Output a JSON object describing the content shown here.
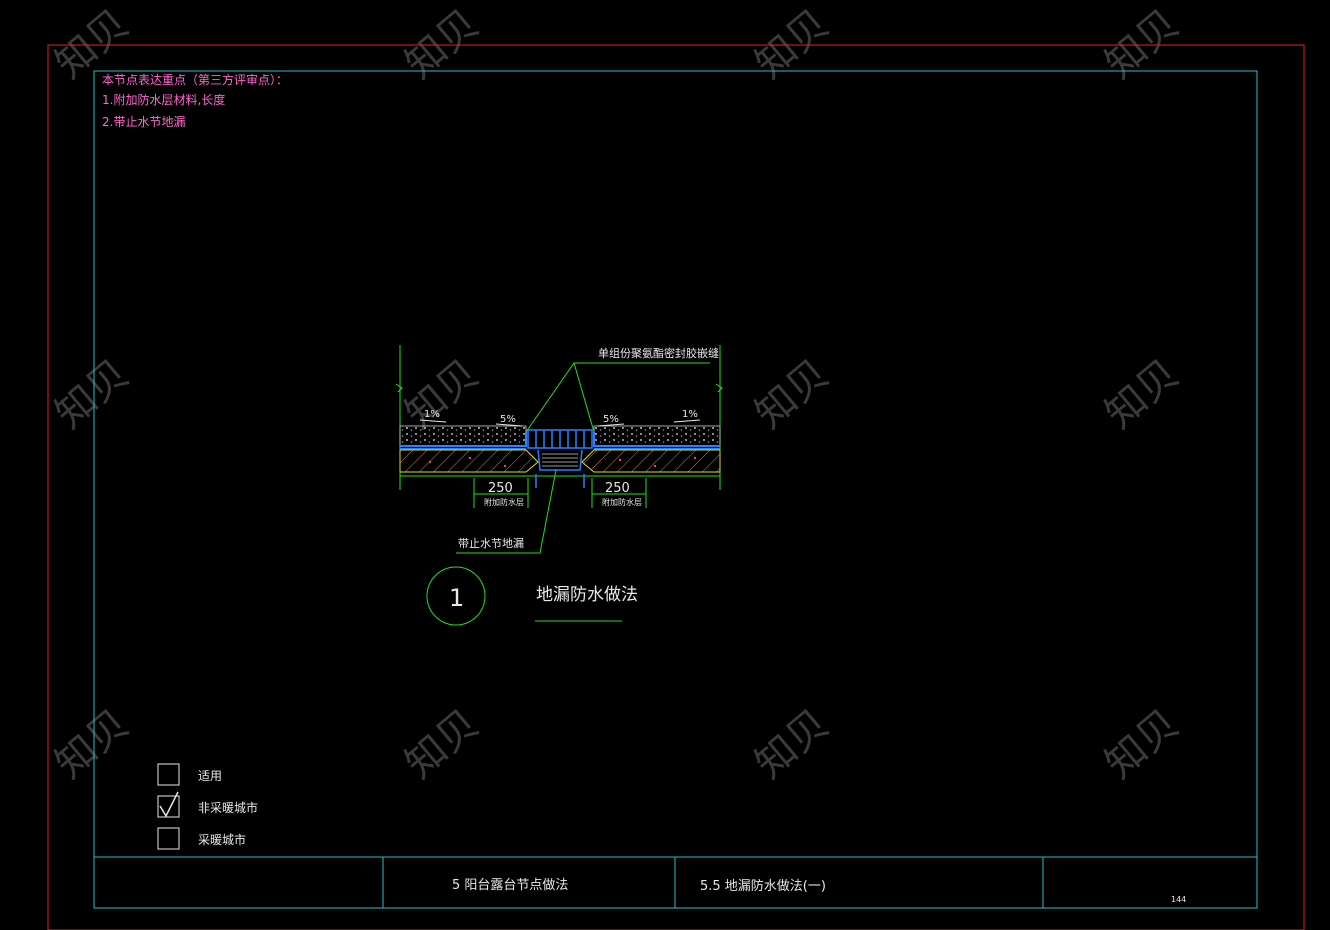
{
  "notes": {
    "heading": "本节点表达重点（第三方评审点）：",
    "items": [
      "1.附加防水层材料,长度",
      "2.带止水节地漏"
    ]
  },
  "detail": {
    "sealant_label": "单组份聚氨酯密封胶嵌缝",
    "drain_label": "带止水节地漏",
    "slopes": [
      "1%",
      "5%",
      "5%",
      "1%"
    ],
    "dimensions": [
      "250",
      "250"
    ],
    "dim_notes": [
      "附加防水层",
      "附加防水层"
    ],
    "number": "1",
    "title": "地漏防水做法"
  },
  "checklist": [
    {
      "label": "适用",
      "checked": false
    },
    {
      "label": "非采暖城市",
      "checked": true
    },
    {
      "label": "采暖城市",
      "checked": false
    }
  ],
  "title_block": {
    "section": "5  阳台露台节点做法",
    "subsection": "5.5  地漏防水做法(一)",
    "page": "144"
  },
  "watermark": "知贝",
  "colors": {
    "outer_frame": "#e0202a",
    "inner_frame": "#25c0c8",
    "notes_text": "#ff66cc",
    "green": "#22dd22",
    "yellow": "#dddd22",
    "blue": "#2a7fff",
    "white": "#e8e8e8"
  }
}
